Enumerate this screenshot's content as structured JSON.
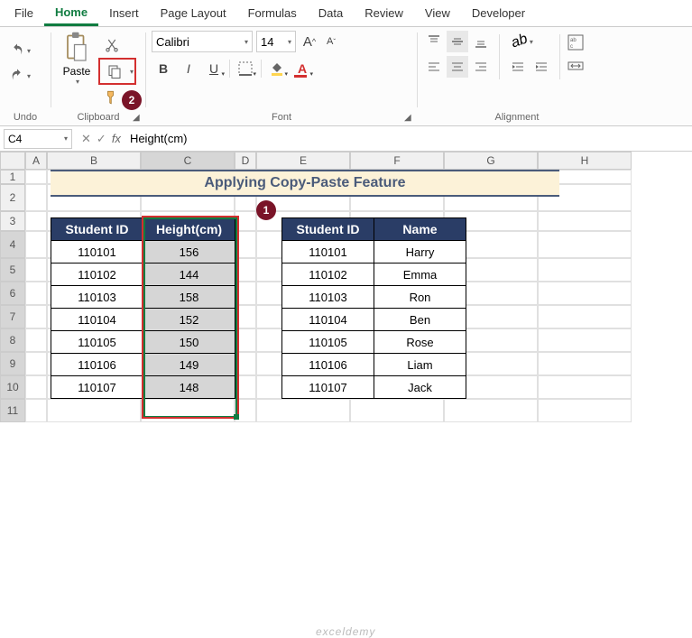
{
  "tabs": [
    "File",
    "Home",
    "Insert",
    "Page Layout",
    "Formulas",
    "Data",
    "Review",
    "View",
    "Developer"
  ],
  "active_tab": "Home",
  "groups": {
    "undo": "Undo",
    "clipboard": "Clipboard",
    "font": "Font",
    "alignment": "Alignment"
  },
  "clipboard": {
    "paste": "Paste"
  },
  "font": {
    "name": "Calibri",
    "size": "14",
    "grow": "A",
    "shrink": "A",
    "bold": "B",
    "italic": "I",
    "underline": "U"
  },
  "namebox": "C4",
  "formula": "Height(cm)",
  "banner": "Applying Copy-Paste Feature",
  "table1": {
    "headers": [
      "Student ID",
      "Height(cm)"
    ],
    "rows": [
      [
        "110101",
        "156"
      ],
      [
        "110102",
        "144"
      ],
      [
        "110103",
        "158"
      ],
      [
        "110104",
        "152"
      ],
      [
        "110105",
        "150"
      ],
      [
        "110106",
        "149"
      ],
      [
        "110107",
        "148"
      ]
    ]
  },
  "table2": {
    "headers": [
      "Student ID",
      "Name"
    ],
    "rows": [
      [
        "110101",
        "Harry"
      ],
      [
        "110102",
        "Emma"
      ],
      [
        "110103",
        "Ron"
      ],
      [
        "110104",
        "Ben"
      ],
      [
        "110105",
        "Rose"
      ],
      [
        "110106",
        "Liam"
      ],
      [
        "110107",
        "Jack"
      ]
    ]
  },
  "cols": [
    "A",
    "B",
    "C",
    "D",
    "E",
    "F",
    "G",
    "H"
  ],
  "watermark": "exceldemy",
  "badges": {
    "b1": "1",
    "b2": "2"
  }
}
